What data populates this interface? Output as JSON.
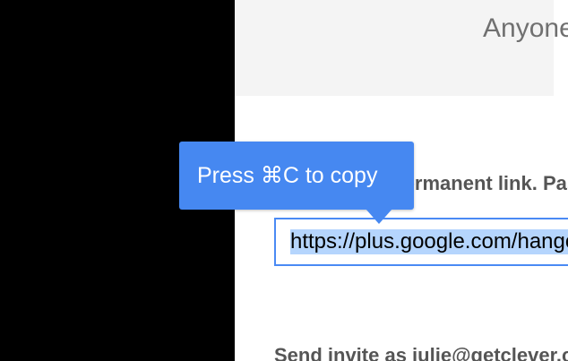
{
  "dialog": {
    "header_title": "Anyone with the link",
    "link_label": "Permanent link. Paste it anywhere",
    "link_value": "https://plus.google.com/hangouts/_/getclever",
    "invite_label": "Send invite as julie@getclever.com"
  },
  "tooltip": {
    "text": "Press ⌘C to copy"
  },
  "colors": {
    "accent": "#4688f1",
    "field_border": "#4a8af4",
    "selection": "#b5d5fd",
    "header_bg": "#f4f4f4"
  }
}
